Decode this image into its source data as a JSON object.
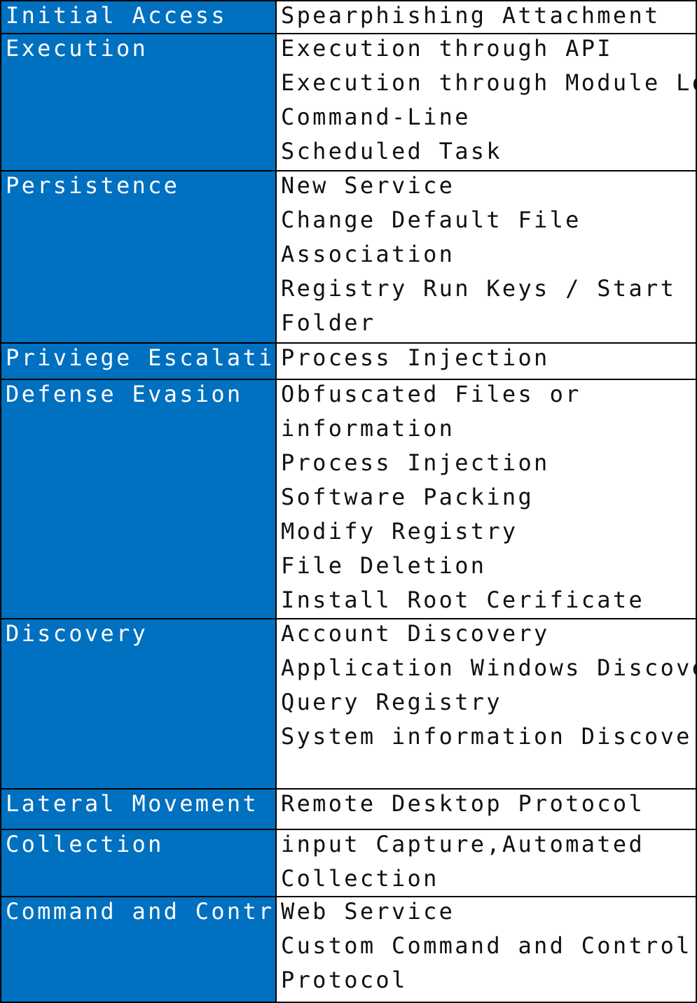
{
  "colors": {
    "tactic_background": "#0070c0",
    "tactic_text": "#ffffff",
    "technique_background": "#ffffff",
    "technique_text": "#111111",
    "border": "#000000"
  },
  "rows": [
    {
      "tactic": "Initial Access",
      "lines": [
        "Spearphishing Attachment"
      ]
    },
    {
      "tactic": "Execution",
      "lines": [
        "Execution through API",
        "Execution through Module Load",
        "Command-Line",
        "Scheduled Task"
      ]
    },
    {
      "tactic": "Persistence",
      "lines": [
        "New Service",
        "Change Default File",
        "Association",
        "Registry Run Keys / Start",
        "Folder"
      ]
    },
    {
      "tactic": "Priviege Escalation",
      "lines": [
        "Process Injection"
      ]
    },
    {
      "tactic": "Defense Evasion",
      "lines": [
        "Obfuscated Files or",
        "information",
        "Process Injection",
        "Software Packing",
        "Modify Registry",
        "File Deletion",
        "Install Root Cerificate"
      ]
    },
    {
      "tactic": "Discovery",
      "lines": [
        "Account Discovery",
        "Application Windows Discovery",
        "Query Registry",
        "System information Discovery"
      ]
    },
    {
      "tactic": "Lateral Movement",
      "lines": [
        "Remote Desktop Protocol"
      ]
    },
    {
      "tactic": "Collection",
      "lines": [
        "input Capture,Automated",
        "Collection"
      ]
    },
    {
      "tactic": "Command and Control",
      "lines": [
        "Web Service",
        "Custom Command and Control",
        "Protocol"
      ]
    }
  ]
}
